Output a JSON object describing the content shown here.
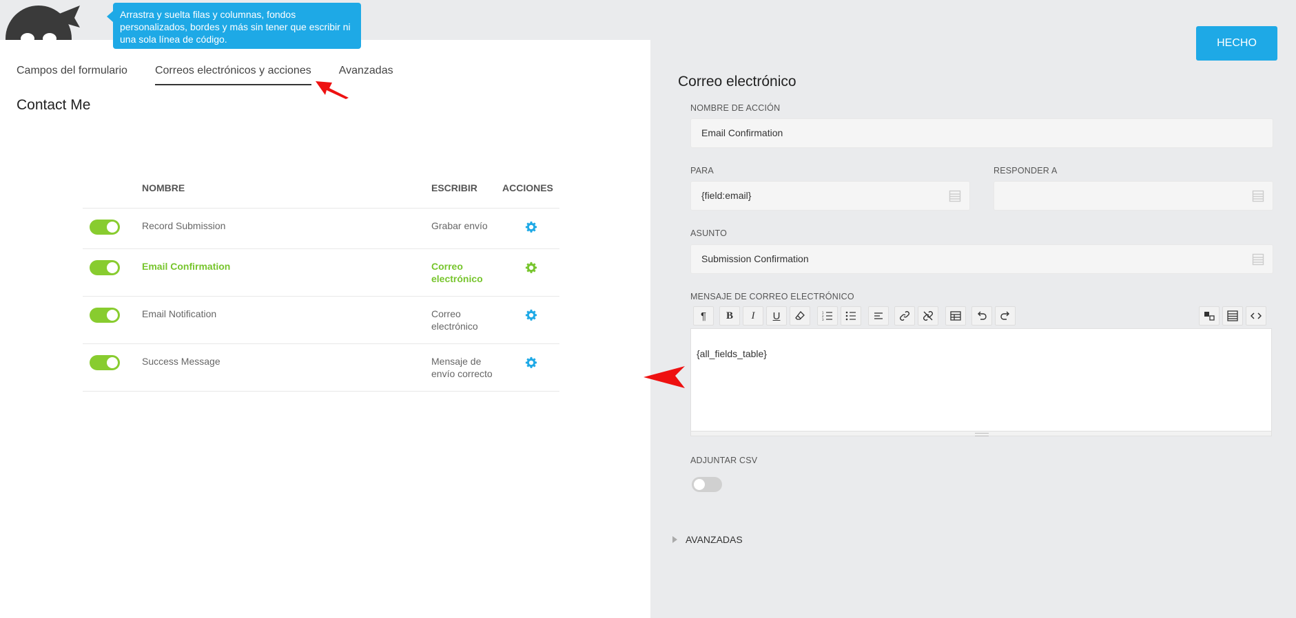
{
  "tooltip": {
    "text": "Arrastra y suelta filas y columnas, fondos personalizados, bordes y más sin tener que escribir ni una sola línea de código."
  },
  "tabs": [
    {
      "label": "Campos del formulario"
    },
    {
      "label": "Correos electrónicos y acciones"
    },
    {
      "label": "Avanzadas"
    }
  ],
  "form": {
    "title": "Contact Me"
  },
  "table": {
    "headers": {
      "name": "NOMBRE",
      "type": "ESCRIBIR",
      "actions": "ACCIONES"
    },
    "rows": [
      {
        "name": "Record Submission",
        "type": "Grabar envío",
        "enabled": true
      },
      {
        "name": "Email Confirmation",
        "type": "Correo electrónico",
        "enabled": true
      },
      {
        "name": "Email Notification",
        "type": "Correo electrónico",
        "enabled": true
      },
      {
        "name": "Success Message",
        "type": "Mensaje de envío correcto",
        "enabled": true
      }
    ]
  },
  "panel": {
    "done_label": "HECHO",
    "title": "Correo electrónico",
    "action_name_label": "NOMBRE DE ACCIÓN",
    "action_name_value": "Email Confirmation",
    "to_label": "PARA",
    "to_value": "{field:email}",
    "reply_to_label": "RESPONDER A",
    "reply_to_value": "",
    "subject_label": "ASUNTO",
    "subject_value": "Submission Confirmation",
    "message_label": "MENSAJE DE CORREO ELECTRÓNICO",
    "message_value": "{all_fields_table}",
    "attach_csv_label": "ADJUNTAR CSV",
    "attach_csv_enabled": false,
    "advanced_label": "AVANZADAS"
  },
  "colors": {
    "accent_blue": "#1ea9e6",
    "toggle_green": "#88cc2f",
    "active_text_green": "#77c52d",
    "annotation_red": "#ee1111"
  },
  "icons": {
    "toolbar": [
      "paragraph-icon",
      "bold-icon",
      "italic-icon",
      "underline-icon",
      "eraser-icon",
      "ordered-list-icon",
      "unordered-list-icon",
      "align-left-icon",
      "link-icon",
      "unlink-icon",
      "table-icon",
      "undo-icon",
      "redo-icon",
      "merge-tags-icon",
      "fields-icon",
      "code-icon"
    ]
  }
}
